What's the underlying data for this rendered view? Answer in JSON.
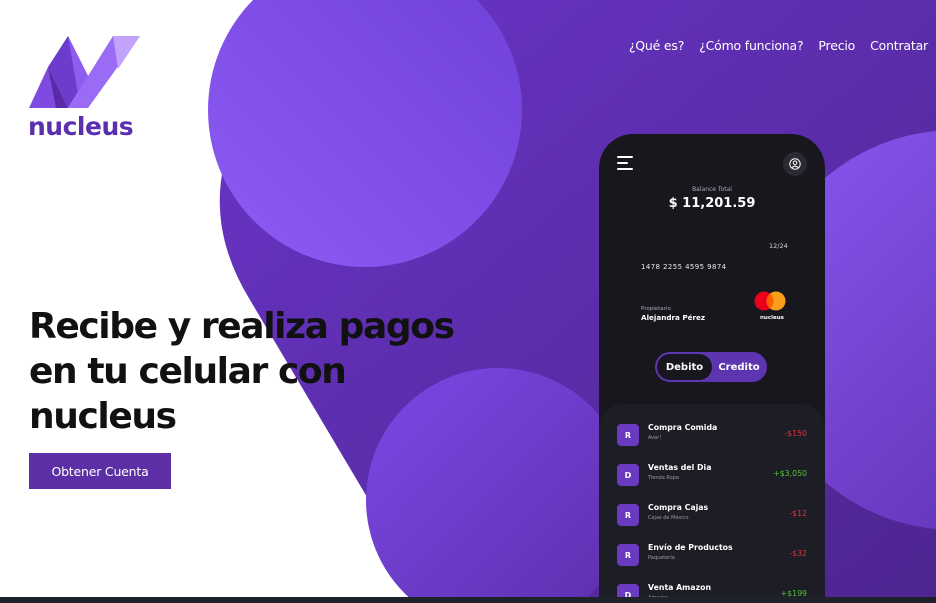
{
  "brand": {
    "name": "nucleus"
  },
  "nav": {
    "items": [
      "¿Qué es?",
      "¿Cómo funciona?",
      "Precio",
      "Contratar"
    ]
  },
  "hero": {
    "headline_lines": [
      "Recibe y realiza pagos",
      "en tu celular con",
      "nucleus"
    ],
    "cta_label": "Obtener Cuenta"
  },
  "phone": {
    "balance_label": "Balance Total",
    "balance_value": "$ 11,201.59",
    "card": {
      "expiry": "12/24",
      "number": "1478 2255 4595 9874",
      "owner_label": "Propietario",
      "owner_name": "Alejandra Pérez",
      "brand": "nucleus"
    },
    "toggle": {
      "debito": "Debito",
      "credito": "Credito"
    },
    "transactions": [
      {
        "initial": "R",
        "title": "Compra Comida",
        "subtitle": "Aver!",
        "amount": "-$150",
        "type": "negative"
      },
      {
        "initial": "D",
        "title": "Ventas del Dia",
        "subtitle": "Tienda Ropa",
        "amount": "+$3,050",
        "type": "positive"
      },
      {
        "initial": "R",
        "title": "Compra Cajas",
        "subtitle": "Cajas de México",
        "amount": "-$12",
        "type": "negative"
      },
      {
        "initial": "R",
        "title": "Envío de Productos",
        "subtitle": "Paquetería",
        "amount": "-$32",
        "type": "negative"
      },
      {
        "initial": "D",
        "title": "Venta Amazon",
        "subtitle": "Amazon",
        "amount": "+$199",
        "type": "positive"
      }
    ]
  },
  "colors": {
    "primary": "#5c2fa6",
    "purple_dark": "#4a2384",
    "purple_light": "#8a58f0",
    "phone_bg": "#17171d",
    "negative": "#e0333f",
    "positive": "#55c33a"
  }
}
